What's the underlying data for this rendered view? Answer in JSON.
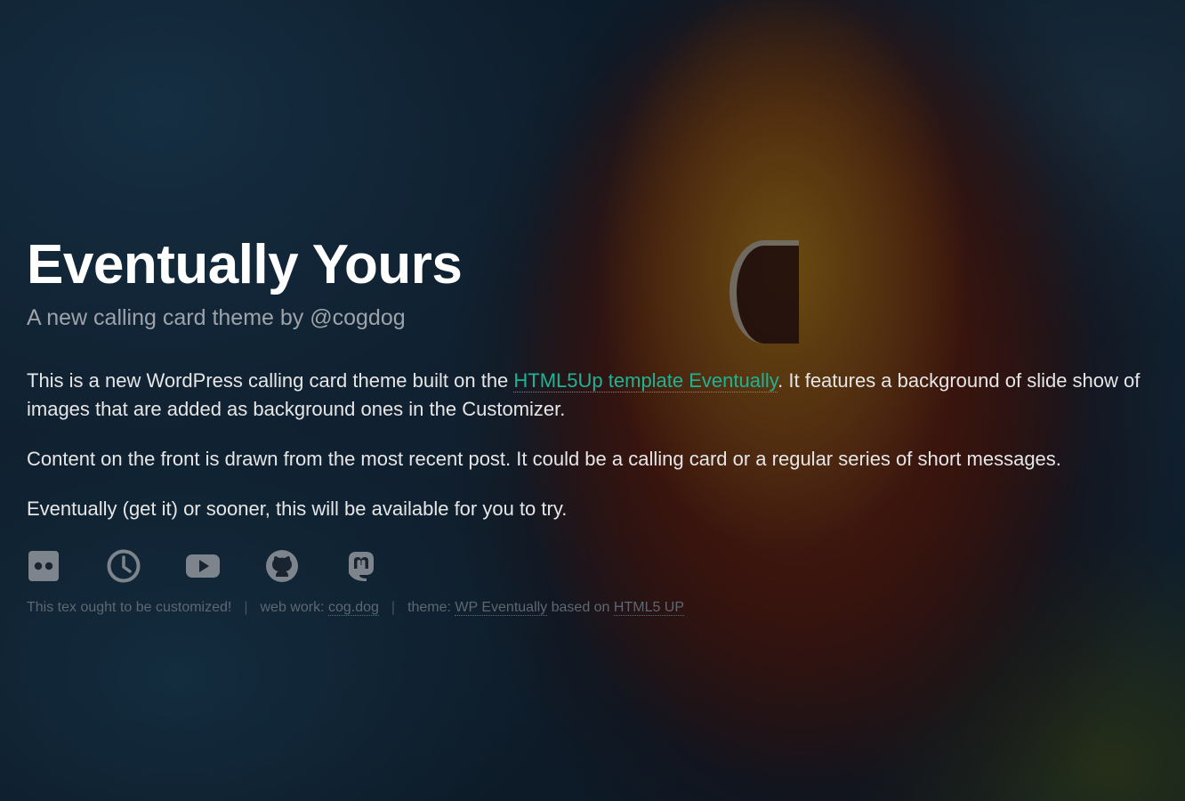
{
  "header": {
    "title": "Eventually Yours",
    "subtitle": "A new calling card theme by @cogdog"
  },
  "post": {
    "p1_before": "This is a new WordPress calling card theme built on the ",
    "p1_link": "HTML5Up template Eventually",
    "p1_after": ". It features a background of slide show of images that are added as background ones in the Customizer.",
    "p2": "Content on the front is drawn from the most recent post. It could be a calling card or a regular series of short messages.",
    "p3": "Eventually (get it) or sooner, this will be available for you to try."
  },
  "social": {
    "icons": [
      "flickr-icon",
      "clock-icon",
      "youtube-icon",
      "github-icon",
      "mastodon-icon"
    ],
    "icon_color": "#7d848b"
  },
  "footer": {
    "custom_text": "This tex ought to be customized!",
    "sep": "|",
    "webwork_prefix": "web work: ",
    "webwork_link": "cog.dog",
    "theme_prefix": "theme: ",
    "theme_link": "WP Eventually",
    "theme_middle": " based on ",
    "theme_link2": "HTML5 UP"
  },
  "colors": {
    "link": "#1cb495",
    "title": "#ffffff",
    "subtitle": "#9ea3a9"
  }
}
